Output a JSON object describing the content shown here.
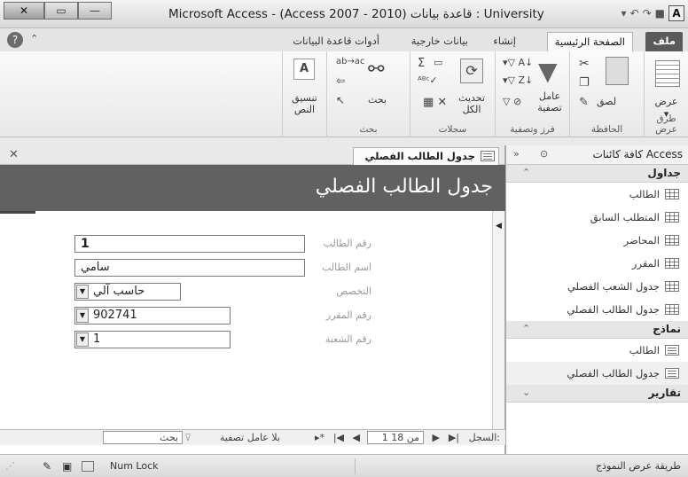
{
  "window": {
    "title": "Microsoft Access - (Access 2007 - 2010) قاعدة بيانات : University"
  },
  "ribbon_tabs": [
    "ملف",
    "الصفحة الرئيسية",
    "إنشاء",
    "بيانات خارجية",
    "أدوات قاعدة البيانات"
  ],
  "ribbon": {
    "view": {
      "label": "عرض",
      "group": "طرق عرض"
    },
    "clipboard": {
      "paste": "لصق",
      "group": "الحافظة"
    },
    "filter": {
      "label": "عامل تصفية",
      "group": "فرز وتصفية"
    },
    "records": {
      "refresh": "تحديث الكل",
      "group": "سجلات"
    },
    "find": {
      "label": "بحث",
      "group": "بحث"
    },
    "text": {
      "label": "تنسيق النص"
    }
  },
  "nav": {
    "title": "كافة كائنات Access",
    "sections": {
      "tables": "جداول",
      "forms": "نماذج",
      "reports": "تقارير"
    },
    "tables": [
      "الطالب",
      "المتطلب السابق",
      "المحاضر",
      "المقرر",
      "جدول الشعب الفصلي",
      "جدول الطالب الفصلي"
    ],
    "forms": [
      "الطالب",
      "جدول الطالب الفصلي"
    ]
  },
  "doc": {
    "tab": "جدول الطالب الفصلي",
    "form_title": "جدول الطالب الفصلي",
    "fields": [
      {
        "label": "رقم الطالب",
        "value": "1"
      },
      {
        "label": "اسم الطالب",
        "value": "سامي"
      },
      {
        "label": "التخصص",
        "value": "حاسب آلي"
      },
      {
        "label": "رقم المقرر",
        "value": "902741"
      },
      {
        "label": "رقم الشعبة",
        "value": "1"
      }
    ]
  },
  "recnav": {
    "label": "السجل:",
    "position": "1 من 18",
    "no_filter": "بلا عامل تصفية",
    "search": "بحث"
  },
  "status": {
    "mode": "طريقة عرض النموذج",
    "numlock": "Num Lock"
  }
}
